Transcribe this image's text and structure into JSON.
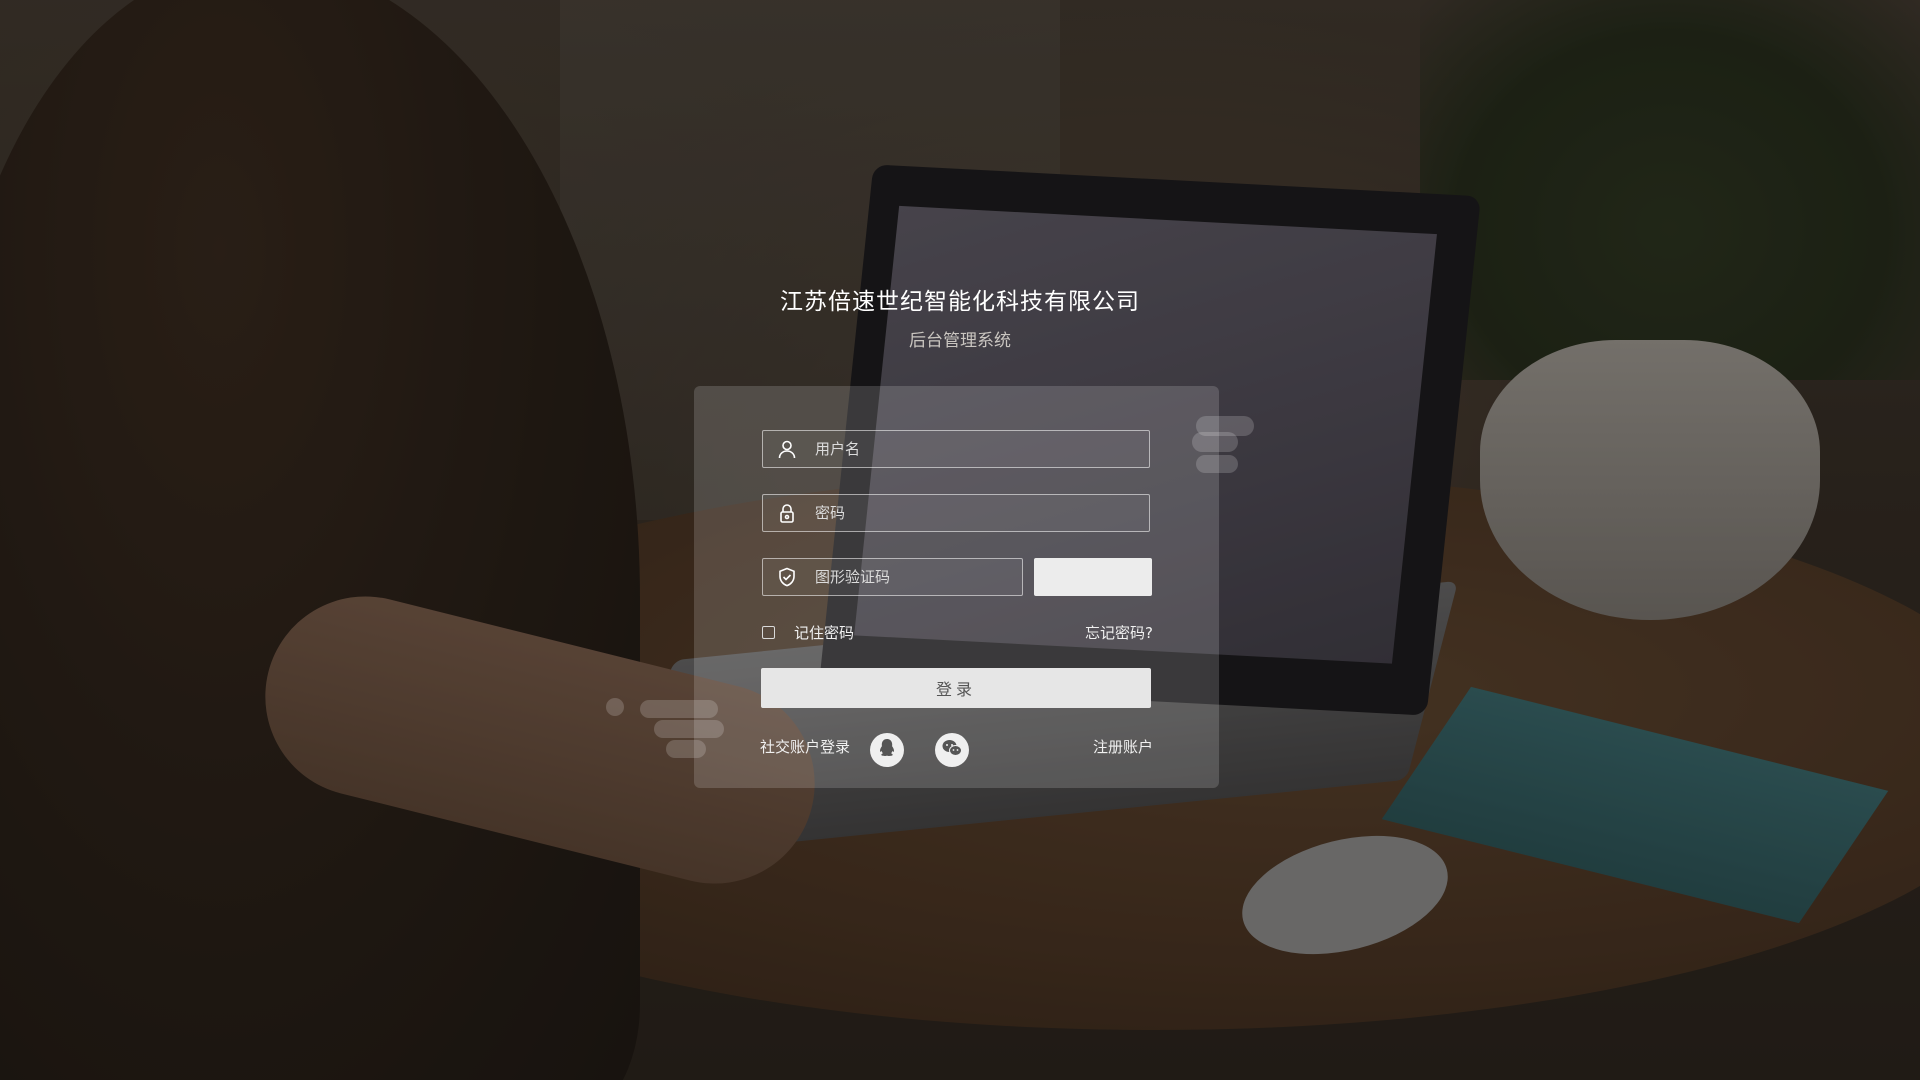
{
  "header": {
    "company_name": "江苏倍速世纪智能化科技有限公司",
    "system_name": "后台管理系统"
  },
  "login_form": {
    "username": {
      "placeholder": "用户名",
      "value": "",
      "icon": "user-icon"
    },
    "password": {
      "placeholder": "密码",
      "value": "",
      "icon": "lock-icon"
    },
    "captcha": {
      "placeholder": "图形验证码",
      "value": "",
      "icon": "shield-icon"
    },
    "remember_label": "记住密码",
    "forgot_label": "忘记密码?",
    "login_label": "登录"
  },
  "footer": {
    "social_label": "社交账户登录",
    "social_icons": [
      "qq-icon",
      "wechat-icon"
    ],
    "register_label": "注册账户"
  },
  "colors": {
    "panel_bg": "rgba(255,255,255,0.16)",
    "login_button": "#e6e6e6",
    "text": "#ffffff"
  }
}
